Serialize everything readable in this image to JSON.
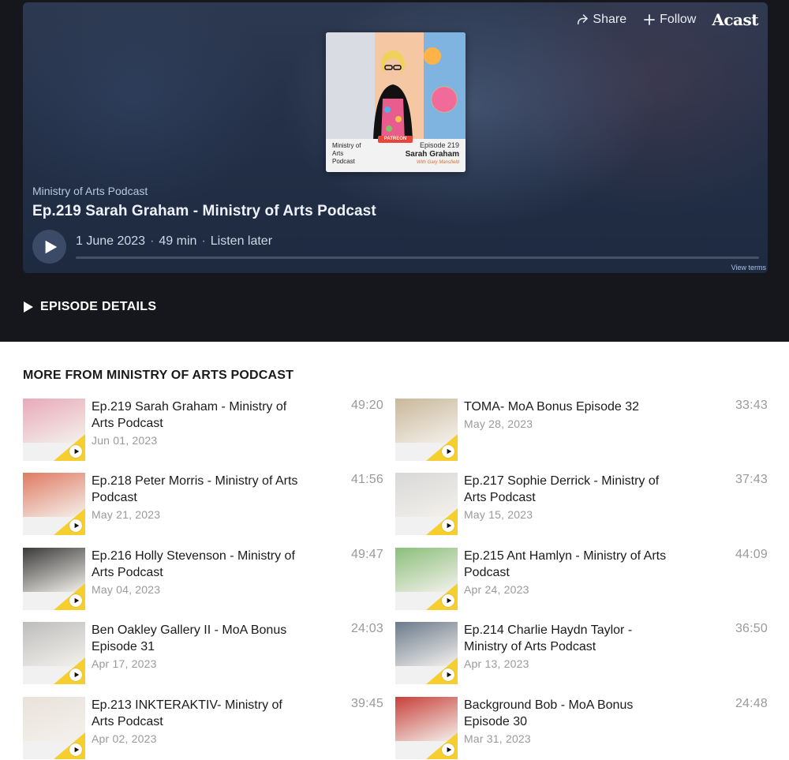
{
  "top_actions": {
    "share_label": "Share",
    "follow_label": "Follow",
    "brand": "Acast"
  },
  "cover": {
    "show_text": "Ministry of Arts Podcast",
    "episode_text": "Episode 219",
    "guest_text": "Sarah Graham",
    "host_text": "With Gary Mansfield",
    "badge_text": "PATREON"
  },
  "player": {
    "show_name": "Ministry of Arts Podcast",
    "title": "Ep.219 Sarah Graham - Ministry of Arts Podcast",
    "date": "1 June 2023",
    "duration": "49 min",
    "listen_later": "Listen later",
    "separator": "·",
    "progress": 0,
    "view_terms": "View terms"
  },
  "episode_details_label": "EPISODE DETAILS",
  "more": {
    "heading": "MORE FROM MINISTRY OF ARTS PODCAST",
    "episodes": [
      {
        "title": "Ep.219 Sarah Graham - Ministry of Arts Podcast",
        "date": "Jun 01, 2023",
        "duration": "49:20"
      },
      {
        "title": "TOMA- MoA Bonus Episode 32",
        "date": "May 28, 2023",
        "duration": "33:43"
      },
      {
        "title": "Ep.218 Peter Morris - Ministry of Arts Podcast",
        "date": "May 21, 2023",
        "duration": "41:56"
      },
      {
        "title": "Ep.217 Sophie Derrick - Ministry of Arts Podcast",
        "date": "May 15, 2023",
        "duration": "37:43"
      },
      {
        "title": "Ep.216 Holly Stevenson - Ministry of Arts Podcast",
        "date": "May 04, 2023",
        "duration": "49:47"
      },
      {
        "title": "Ep.215 Ant Hamlyn - Ministry of Arts Podcast",
        "date": "Apr 24, 2023",
        "duration": "44:09"
      },
      {
        "title": "Ben Oakley Gallery II - MoA Bonus Episode 31",
        "date": "Apr 17, 2023",
        "duration": "24:03"
      },
      {
        "title": "Ep.214 Charlie Haydn Taylor - Ministry of Arts Podcast",
        "date": "Apr 13, 2023",
        "duration": "36:50"
      },
      {
        "title": "Ep.213 INKTERAKTIV- Ministry of Arts Podcast",
        "date": "Apr 02, 2023",
        "duration": "39:45"
      },
      {
        "title": "Background Bob - MoA Bonus Episode 30",
        "date": "Mar 31, 2023",
        "duration": "24:48"
      }
    ]
  },
  "thumb_colors": [
    "#e9a9b8",
    "#c9b89a",
    "#e07a62",
    "#d8d8d8",
    "#3a3a3a",
    "#8bbf7a",
    "#bdbdbd",
    "#6b7a8c",
    "#e8e2da",
    "#c8403a"
  ]
}
